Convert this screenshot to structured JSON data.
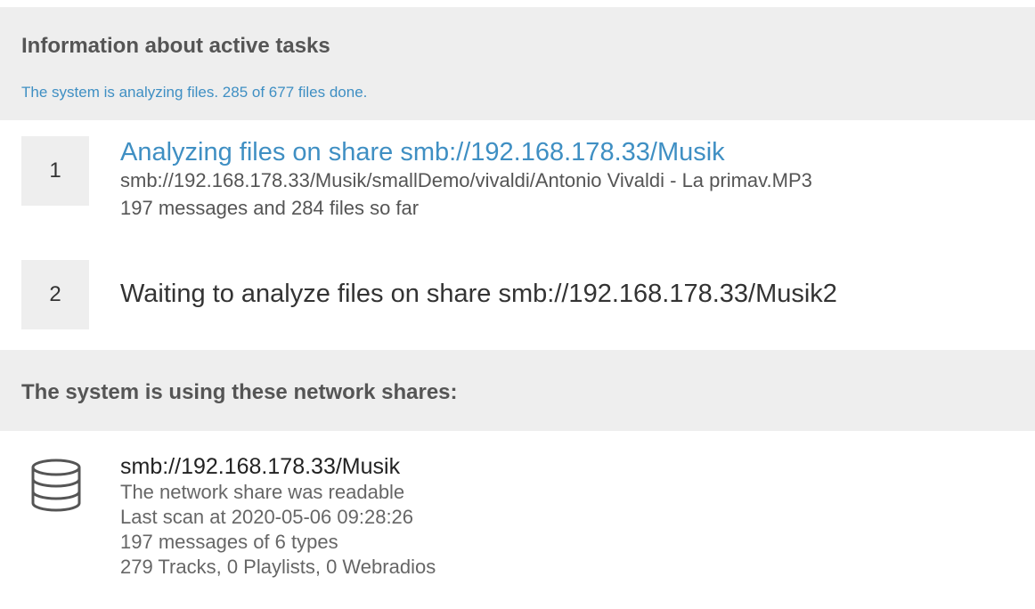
{
  "tasks_panel": {
    "title": "Information about active tasks",
    "status": "The system is analyzing files. 285 of 677 files done."
  },
  "tasks": [
    {
      "number": "1",
      "title": "Analyzing files on share smb://192.168.178.33/Musik",
      "current_file": "smb://192.168.178.33/Musik/smallDemo/vivaldi/Antonio Vivaldi - La primav.MP3",
      "progress": "197 messages and 284 files so far"
    },
    {
      "number": "2",
      "title": "Waiting to analyze files on share smb://192.168.178.33/Musik2"
    }
  ],
  "shares_panel": {
    "title": "The system is using these network shares:"
  },
  "shares": [
    {
      "icon": "database-icon",
      "name": "smb://192.168.178.33/Musik",
      "state": "The network share was readable",
      "last_scan": "Last scan at 2020-05-06 09:28:26",
      "messages": "197 messages of 6 types",
      "counts": "279 Tracks, 0 Playlists, 0 Webradios"
    }
  ],
  "colors": {
    "accent": "#3f8fc3",
    "panel_background": "#eeeeee",
    "text": "#333333"
  }
}
